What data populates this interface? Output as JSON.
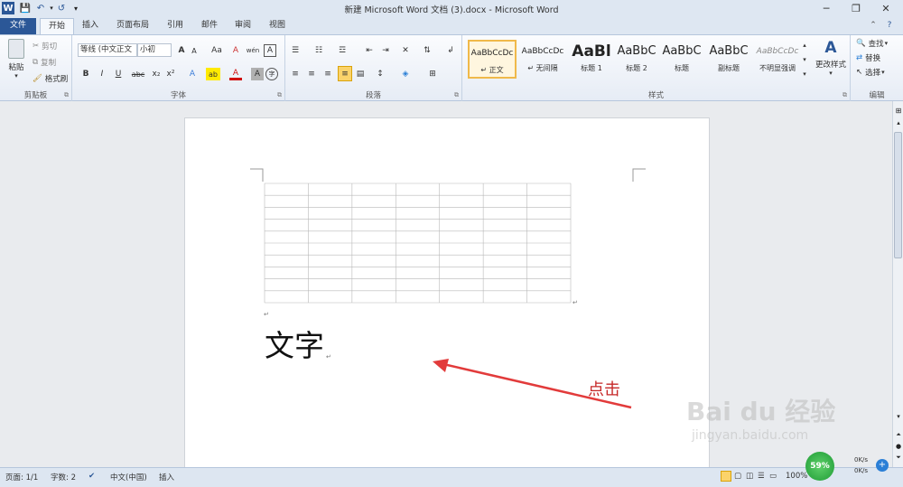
{
  "app": {
    "title": "新建 Microsoft Word 文档 (3).docx - Microsoft Word"
  },
  "quick_access": {
    "logo": "word-logo-icon",
    "save": "save-icon",
    "undo": "undo-icon",
    "redo": "redo-icon",
    "customize": "customize-arrow-icon"
  },
  "tabs": [
    {
      "label": "文件"
    },
    {
      "label": "开始"
    },
    {
      "label": "插入"
    },
    {
      "label": "页面布局"
    },
    {
      "label": "引用"
    },
    {
      "label": "邮件"
    },
    {
      "label": "审阅"
    },
    {
      "label": "视图"
    }
  ],
  "ribbon": {
    "clipboard": {
      "label": "剪贴板",
      "paste": "粘贴",
      "cut": "剪切",
      "copy": "复制",
      "format_painter": "格式刷"
    },
    "font": {
      "label": "字体",
      "font_name": "等线 (中文正文",
      "font_size": "小初",
      "bold": "B",
      "italic": "I",
      "underline": "U",
      "strike": "abc",
      "subscript": "x₂",
      "superscript": "x²",
      "grow": "A",
      "shrink": "A",
      "case": "Aa",
      "clear": "A",
      "phonetic": "wén",
      "border_char": "A",
      "highlight": "ab",
      "color": "A",
      "shade": "A",
      "circle": "字"
    },
    "paragraph": {
      "label": "段落"
    },
    "styles": {
      "label": "样式",
      "items": [
        {
          "preview": "AaBbCcDc",
          "name": "↵ 正文"
        },
        {
          "preview": "AaBbCcDc",
          "name": "↵ 无间隔"
        },
        {
          "preview": "AaBl",
          "name": "标题 1"
        },
        {
          "preview": "AaBbC",
          "name": "标题 2"
        },
        {
          "preview": "AaBbC",
          "name": "标题"
        },
        {
          "preview": "AaBbC",
          "name": "副标题"
        },
        {
          "preview": "AaBbCcDc",
          "name": "不明显强调"
        }
      ],
      "change_styles": "更改样式"
    },
    "editing": {
      "label": "编辑",
      "find": "查找",
      "replace": "替换",
      "select": "选择"
    }
  },
  "document": {
    "text": "文字",
    "table": {
      "rows": 10,
      "cols": 7
    },
    "annotation": "点击"
  },
  "watermark": {
    "logo": "Bai du 经验",
    "url": "jingyan.baidu.com"
  },
  "status": {
    "page": "页面: 1/1",
    "words": "字数: 2",
    "language": "中文(中国)",
    "mode": "插入",
    "zoom": "100%"
  },
  "netmon": {
    "percent": "59%",
    "up": "0K/s",
    "down": "0K/s"
  },
  "colors": {
    "accent": "#2b5797",
    "arrow": "#e23b3b",
    "table_line": "#b8b8b8"
  }
}
